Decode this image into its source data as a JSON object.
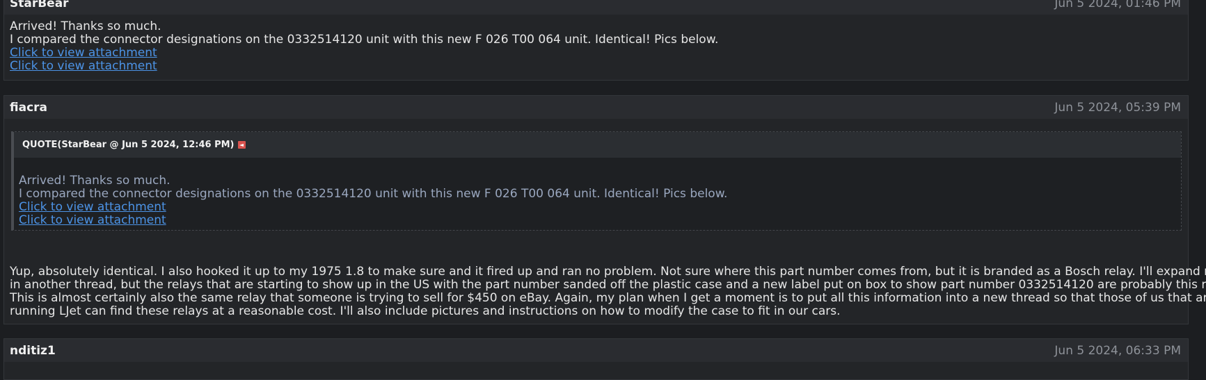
{
  "posts": [
    {
      "author": "StarBear",
      "date": "Jun 5 2024, 01:46 PM",
      "lines": [
        "Arrived! Thanks so much.",
        "I compared the connector designations on the 0332514120 unit with this new F 026 T00 064 unit. Identical! Pics below."
      ],
      "attachments": [
        "Click to view attachment",
        "Click to view attachment"
      ]
    },
    {
      "author": "fiacra",
      "date": "Jun 5 2024, 05:39 PM",
      "quote": {
        "header": "QUOTE(StarBear @ Jun 5 2024, 12:46 PM)",
        "lines": [
          "Arrived! Thanks so much.",
          "I compared the connector designations on the 0332514120 unit with this new F 026 T00 064 unit. Identical! Pics below."
        ],
        "attachments": [
          "Click to view attachment",
          "Click to view attachment"
        ]
      },
      "reply_lines": [
        "Yup, absolutely identical. I also hooked it up to my 1975 1.8 to make sure and it fired up and ran no problem. Not sure where this part number comes from, but it is branded as a Bosch relay. I'll expand more",
        "in another thread, but the relays that are starting to show up in the US with the part number sanded off the plastic case and a new label put on box to show part number 0332514120 are probably this relay.",
        "This is almost certainly also the same relay that someone is trying to sell for $450 on eBay. Again, my plan when I get a moment is to put all this information into a new thread so that those of us that are",
        "running LJet can find these relays at a reasonable cost. I'll also include pictures and instructions on how to modify the case to fit in our cars."
      ]
    },
    {
      "author": "nditiz1",
      "date": "Jun 5 2024, 06:33 PM"
    }
  ]
}
